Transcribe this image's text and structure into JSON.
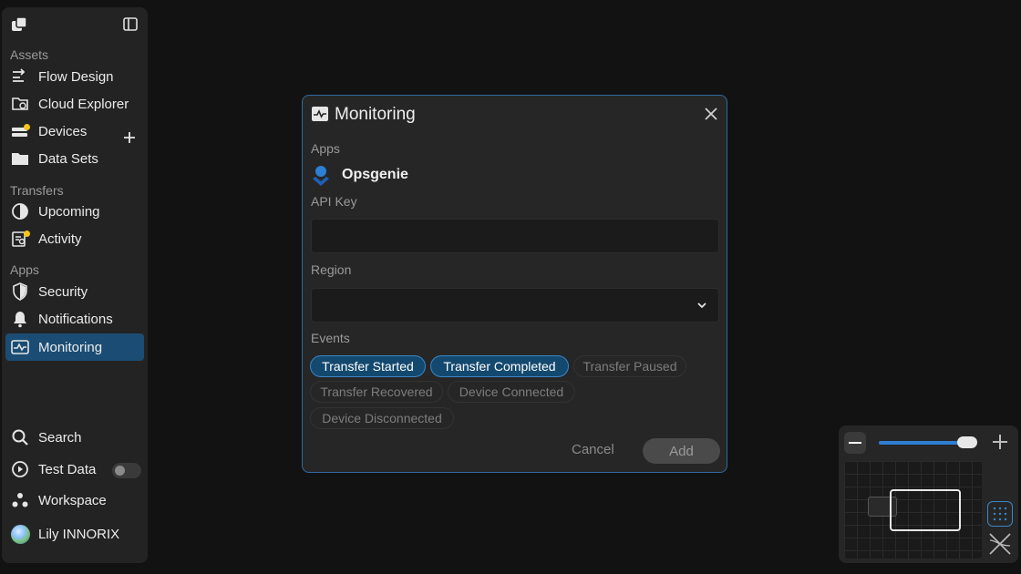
{
  "sidebar": {
    "sections": {
      "assets": "Assets",
      "transfers": "Transfers",
      "apps": "Apps"
    },
    "items": [
      {
        "label": "Flow Design",
        "icon": "flow-icon"
      },
      {
        "label": "Cloud Explorer",
        "icon": "cloud-folder-icon"
      },
      {
        "label": "Devices",
        "icon": "devices-icon"
      },
      {
        "label": "Data Sets",
        "icon": "folder-icon"
      },
      {
        "label": "Upcoming",
        "icon": "pie-clock-icon"
      },
      {
        "label": "Activity",
        "icon": "activity-search-icon"
      },
      {
        "label": "Security",
        "icon": "shield-icon"
      },
      {
        "label": "Notifications",
        "icon": "bell-icon"
      },
      {
        "label": "Monitoring",
        "icon": "monitoring-icon"
      }
    ],
    "bottom": {
      "search": "Search",
      "test_data": "Test Data",
      "workspace": "Workspace",
      "user": "Lily INNORIX"
    }
  },
  "modal": {
    "title": "Monitoring",
    "apps_label": "Apps",
    "app_name": "Opsgenie",
    "api_key_label": "API Key",
    "api_key_value": "",
    "region_label": "Region",
    "region_value": "",
    "events_label": "Events",
    "events": [
      {
        "label": "Transfer Started",
        "selected": true
      },
      {
        "label": "Transfer Completed",
        "selected": true
      },
      {
        "label": "Transfer Paused",
        "selected": false
      },
      {
        "label": "Transfer Recovered",
        "selected": false
      },
      {
        "label": "Device Connected",
        "selected": false
      },
      {
        "label": "Device Disconnected",
        "selected": false
      }
    ],
    "cancel_label": "Cancel",
    "add_label": "Add"
  },
  "minimap": {
    "zoom_level": 0.92
  },
  "colors": {
    "accent": "#2d7fd3",
    "active_nav": "#1b4d74",
    "badge": "#f5c518",
    "chip_selected": "#14496f"
  }
}
